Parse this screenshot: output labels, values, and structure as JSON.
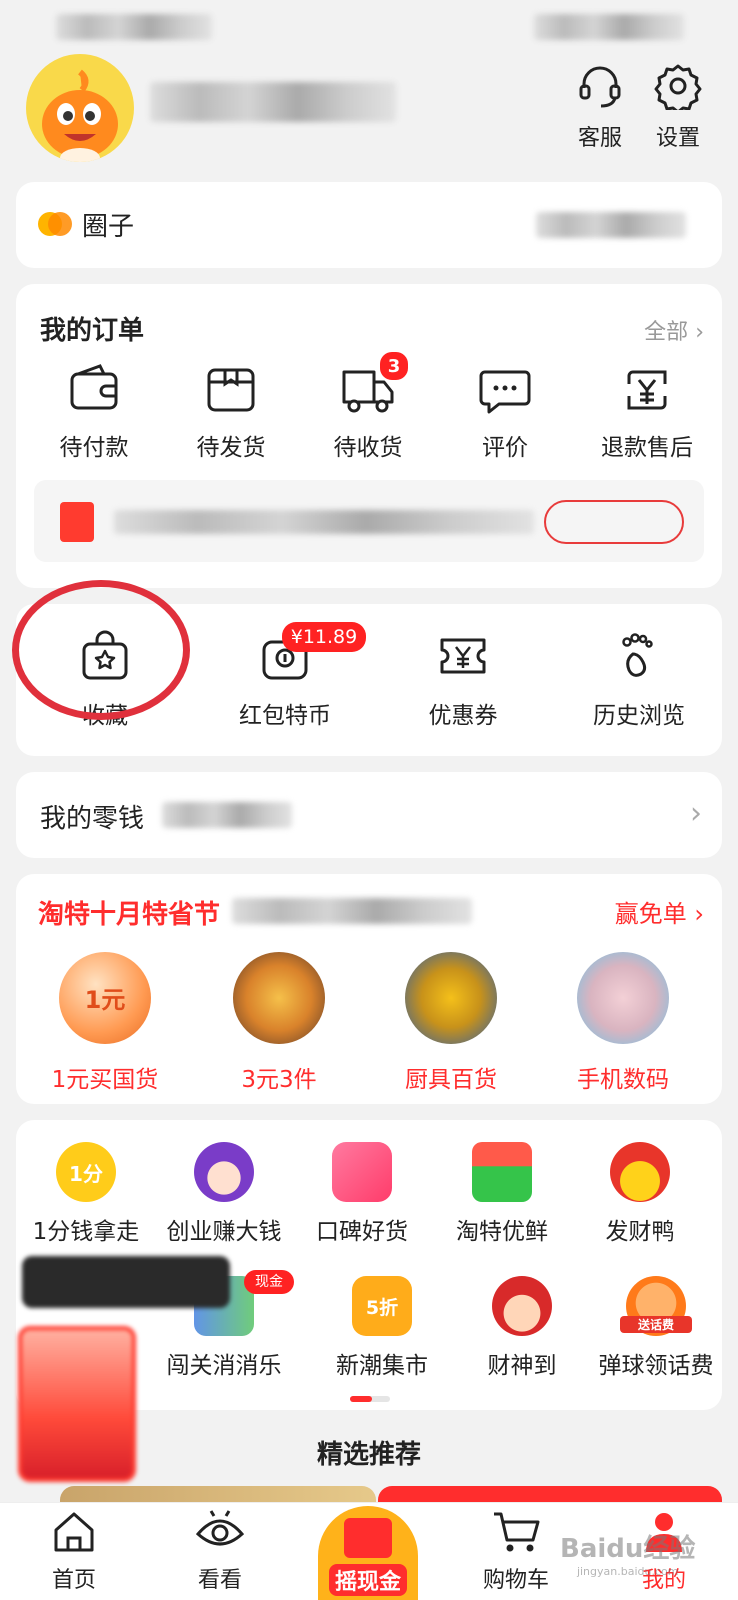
{
  "header": {
    "service_label": "客服",
    "settings_label": "设置"
  },
  "circle": {
    "label": "圈子"
  },
  "orders": {
    "title": "我的订单",
    "all_label": "全部",
    "items": [
      {
        "label": "待付款",
        "icon": "wallet-icon"
      },
      {
        "label": "待发货",
        "icon": "box-icon"
      },
      {
        "label": "待收货",
        "icon": "truck-icon",
        "badge": "3"
      },
      {
        "label": "评价",
        "icon": "chat-icon"
      },
      {
        "label": "退款售后",
        "icon": "refund-icon"
      }
    ]
  },
  "tools": {
    "items": [
      {
        "label": "收藏",
        "icon": "favorite-bag-icon"
      },
      {
        "label": "红包特币",
        "icon": "coin-bag-icon",
        "badge": "¥11.89"
      },
      {
        "label": "优惠券",
        "icon": "coupon-icon"
      },
      {
        "label": "历史浏览",
        "icon": "footprint-icon"
      }
    ]
  },
  "wallet": {
    "label": "我的零钱"
  },
  "promo": {
    "title": "淘特十月特省节",
    "action": "赢免单",
    "items": [
      {
        "label": "1元买国货",
        "thumb_text": "1元"
      },
      {
        "label": "3元3件"
      },
      {
        "label": "厨具百货"
      },
      {
        "label": "手机数码"
      }
    ]
  },
  "services": {
    "row1": [
      {
        "label": "1分钱拿走",
        "icon_text": "1分"
      },
      {
        "label": "创业赚大钱"
      },
      {
        "label": "口碑好货"
      },
      {
        "label": "淘特优鲜"
      },
      {
        "label": "发财鸭"
      }
    ],
    "row2": [
      {
        "label": "闯关消消乐",
        "badge": "现金"
      },
      {
        "label": "新潮集市",
        "icon_text": "5折"
      },
      {
        "label": "财神到"
      },
      {
        "label": "弹球领话费",
        "icon_text": "送话费"
      }
    ]
  },
  "recommend": {
    "title": "精选推荐"
  },
  "nav": {
    "home": "首页",
    "watch": "看看",
    "center": "摇现金",
    "cart": "购物车",
    "mine": "我的"
  },
  "watermark": {
    "text": "Baidu经验",
    "sub": "jingyan.baidu.com"
  },
  "colors": {
    "accent": "#ff2d2d",
    "annotation": "#e0303c",
    "background": "#f2f2f2"
  }
}
